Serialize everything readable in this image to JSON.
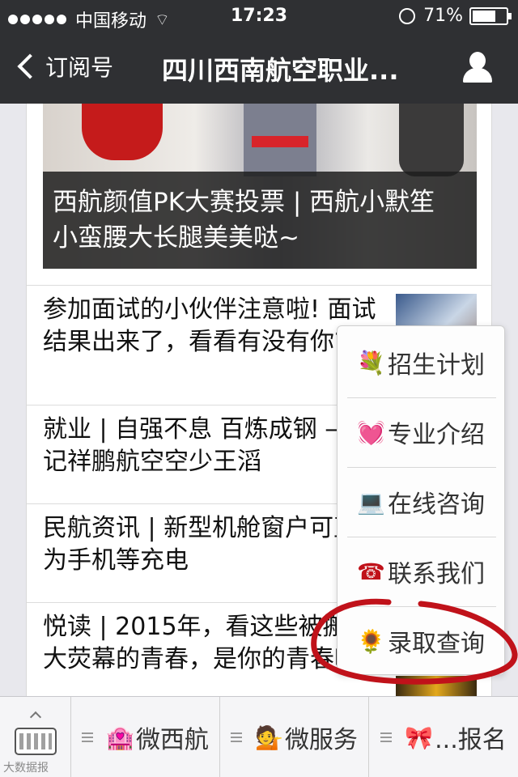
{
  "status_bar": {
    "carrier": "中国移动",
    "time": "17:23",
    "battery": "71%",
    "battery_level": 0.71,
    "icons": [
      "signal-dots-icon",
      "wifi-icon",
      "alarm-icon",
      "battery-icon"
    ]
  },
  "nav": {
    "back_label": "订阅号",
    "title": "四川西南航空职业...",
    "icons": [
      "back-chevron-icon",
      "person-icon"
    ]
  },
  "hero": {
    "caption": "西航颜值PK大赛投票 | 西航小默笙 小蛮腰大长腿美美哒~"
  },
  "articles": [
    {
      "title": "参加面试的小伙伴注意啦! 面试结果出来了，看看有没有你?"
    },
    {
      "title": "就业 | 自强不息  百炼成钢 ——记祥鹏航空空少王滔"
    },
    {
      "title": "民航资讯 |  新型机舱窗户可直接为手机等充电"
    },
    {
      "title": "悦读 | 2015年，看这些被搬上大荧幕的青春，是你的青春吗?"
    }
  ],
  "popup_menu": {
    "items": [
      {
        "label": "招生计划",
        "icon": "💐"
      },
      {
        "label": "专业介绍",
        "icon": "💓"
      },
      {
        "label": "在线咨询",
        "icon": "💻"
      },
      {
        "label": "联系我们",
        "icon": "☎"
      },
      {
        "label": "录取查询",
        "icon": "🌻"
      }
    ]
  },
  "bottom_bar": {
    "tabs": [
      {
        "label": "微西航",
        "icon": "🏩"
      },
      {
        "label": "微服务",
        "icon": "💁"
      },
      {
        "label": "...报名",
        "icon": "🎀"
      }
    ]
  },
  "watermark": "大数据报",
  "colors": {
    "bar_bg": "#2f3033",
    "annotation_red": "#c0121a"
  }
}
